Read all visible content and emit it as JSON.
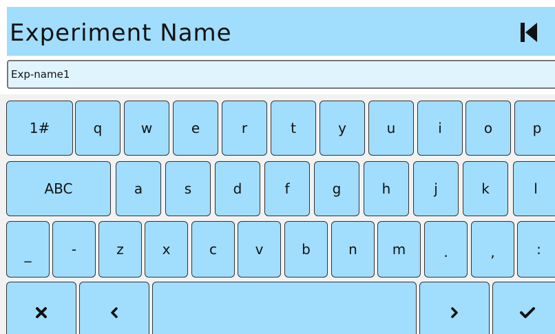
{
  "header": {
    "title": "Experiment Name",
    "back_icon": "skip-back-icon"
  },
  "input": {
    "value": "Exp-name1"
  },
  "keyboard": {
    "row1": [
      "1#",
      "q",
      "w",
      "e",
      "r",
      "t",
      "y",
      "u",
      "i",
      "o",
      "p"
    ],
    "row2": [
      "ABC",
      "a",
      "s",
      "d",
      "f",
      "g",
      "h",
      "j",
      "k",
      "l"
    ],
    "row3": [
      "_",
      "-",
      "z",
      "x",
      "c",
      "v",
      "b",
      "n",
      "m",
      ".",
      ",",
      ":"
    ],
    "row4": {
      "clear_icon": "close-icon",
      "left_icon": "chevron-left-icon",
      "space_label": "",
      "right_icon": "chevron-right-icon",
      "enter_icon": "checkmark-icon"
    }
  },
  "colors": {
    "key_fill": "#a1ddfc",
    "header_fill": "#a1ddfc",
    "input_fill": "#e0f4fe",
    "key_border": "#333333"
  }
}
